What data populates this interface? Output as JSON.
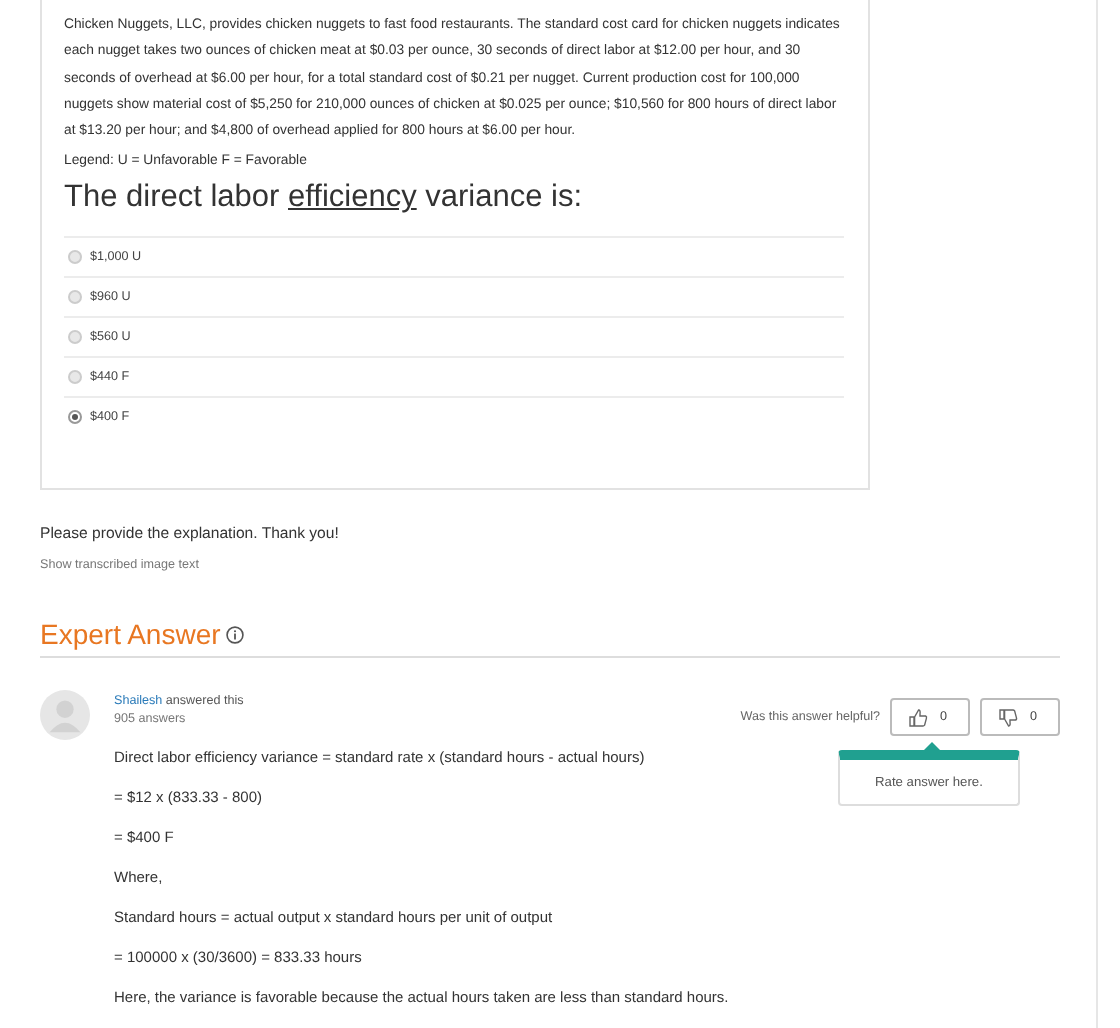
{
  "question": {
    "paragraph": "Chicken Nuggets, LLC, provides chicken nuggets to fast food restaurants. The standard cost card for chicken nuggets indicates each nugget takes two ounces of chicken meat at $0.03 per ounce, 30 seconds of direct labor at $12.00 per hour, and 30 seconds of overhead at $6.00 per hour, for a total standard cost of $0.21 per nugget. Current production cost for 100,000 nuggets show material cost of $5,250 for 210,000 ounces of chicken at $0.025 per ounce; $10,560 for 800 hours of direct labor at $13.20 per hour; and $4,800 of overhead applied for 800 hours at $6.00 per hour.",
    "legend": "Legend: U = Unfavorable F = Favorable",
    "heading": {
      "before": "The direct labor ",
      "term": "efficiency",
      "after": " variance is:"
    },
    "options": [
      {
        "label": "$1,000 U",
        "selected": false
      },
      {
        "label": "$960 U",
        "selected": false
      },
      {
        "label": "$560 U",
        "selected": false
      },
      {
        "label": "$440 F",
        "selected": false
      },
      {
        "label": "$400 F",
        "selected": true
      }
    ]
  },
  "note": "Please provide the explanation. Thank you!",
  "transcribed_link": "Show transcribed image text",
  "expert_answer": {
    "title": "Expert Answer",
    "author": "Shailesh",
    "answered": " answered this",
    "answer_count": "905 answers",
    "helpful_prompt": "Was this answer helpful?",
    "thumbs_up": "0",
    "thumbs_down": "0",
    "tooltip": "Rate answer here.",
    "lines": [
      "Direct labor efficiency variance = standard rate x (standard hours - actual hours)",
      "= $12 x (833.33 - 800)",
      "= $400 F",
      "Where,",
      "Standard hours = actual output x standard hours per unit of output",
      "= 100000 x (30/3600) = 833.33 hours",
      "Here, the variance is favorable because the actual hours taken are less than standard hours."
    ]
  }
}
